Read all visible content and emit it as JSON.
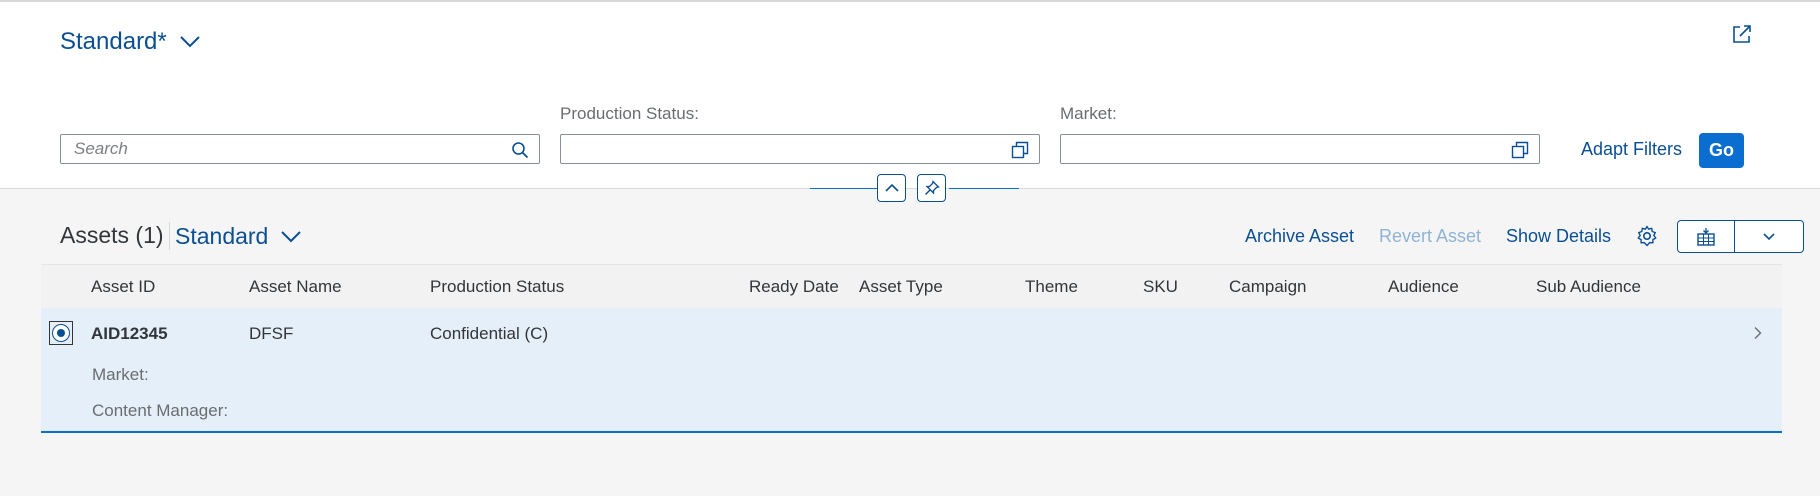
{
  "header": {
    "variant_title": "Standard*",
    "filters": {
      "search_placeholder": "Search",
      "production_status_label": "Production Status:",
      "production_status_value": "",
      "market_label": "Market:",
      "market_value": ""
    },
    "adapt_filters_label": "Adapt Filters",
    "go_label": "Go"
  },
  "toolbar": {
    "title": "Assets (1)",
    "variant": "Standard",
    "actions": {
      "archive": "Archive Asset",
      "revert": "Revert Asset",
      "show_details": "Show Details"
    }
  },
  "table": {
    "columns": [
      "Asset ID",
      "Asset Name",
      "Production Status",
      "Ready Date",
      "Asset Type",
      "Theme",
      "SKU",
      "Campaign",
      "Audience",
      "Sub Audience"
    ],
    "rows": [
      {
        "asset_id": "AID12345",
        "asset_name": "DFSF",
        "production_status": "Confidential (C)",
        "market_label": "Market:",
        "content_manager_label": "Content Manager:",
        "selected": true
      }
    ]
  },
  "colors": {
    "accent": "#0a6ed1",
    "link": "#0a4f94",
    "row_selected": "#e5eff9"
  },
  "icons": [
    "chevron-down-icon",
    "share-icon",
    "search-icon",
    "value-help-icon",
    "collapse-icon",
    "pin-icon",
    "settings-gear-icon",
    "export-icon",
    "chevron-right-icon"
  ]
}
